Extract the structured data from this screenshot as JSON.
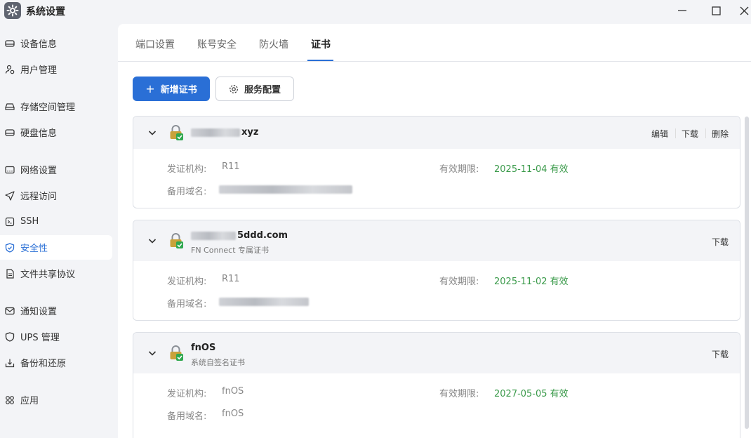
{
  "window": {
    "title": "系统设置",
    "controls": {
      "minimize": "—",
      "maximize": "☐",
      "close": "✕"
    }
  },
  "sidebar": {
    "items": [
      {
        "label": "设备信息",
        "icon": "device-icon"
      },
      {
        "label": "用户管理",
        "icon": "users-icon"
      },
      {
        "label": "存储空间管理",
        "icon": "storage-icon"
      },
      {
        "label": "硬盘信息",
        "icon": "disk-icon"
      },
      {
        "label": "网络设置",
        "icon": "network-icon"
      },
      {
        "label": "远程访问",
        "icon": "send-icon"
      },
      {
        "label": "SSH",
        "icon": "terminal-icon"
      },
      {
        "label": "安全性",
        "icon": "shield-icon",
        "active": true
      },
      {
        "label": "文件共享协议",
        "icon": "file-icon"
      },
      {
        "label": "通知设置",
        "icon": "mail-icon"
      },
      {
        "label": "UPS 管理",
        "icon": "ups-shield-icon"
      },
      {
        "label": "备份和还原",
        "icon": "backup-icon"
      },
      {
        "label": "应用",
        "icon": "apps-icon"
      }
    ]
  },
  "tabs": [
    {
      "label": "端口设置"
    },
    {
      "label": "账号安全"
    },
    {
      "label": "防火墙"
    },
    {
      "label": "证书",
      "active": true
    }
  ],
  "toolbar": {
    "add_label": "新增证书",
    "add_symbol": "+",
    "config_label": "服务配置"
  },
  "labels": {
    "issuer": "发证机构:",
    "expiry": "有效期限:",
    "alt_names": "备用域名:"
  },
  "certificates": [
    {
      "name_suffix": "xyz",
      "subtitle": "",
      "issuer": "R11",
      "expiry": "2025-11-04 有效",
      "alt_names": "",
      "actions": [
        "编辑",
        "下载",
        "删除"
      ]
    },
    {
      "name_suffix": "5ddd.com",
      "subtitle": "FN Connect 专属证书",
      "issuer": "R11",
      "expiry": "2025-11-02 有效",
      "alt_names": "",
      "actions": [
        "下载"
      ]
    },
    {
      "name": "fnOS",
      "subtitle": "系统自签名证书",
      "issuer": "fnOS",
      "expiry": "2027-05-05 有效",
      "alt_names": "fnOS",
      "actions": [
        "下载"
      ]
    }
  ],
  "colors": {
    "accent": "#2a6fd6",
    "valid": "#3a9a4a",
    "card_header": "#f3f4f7"
  }
}
